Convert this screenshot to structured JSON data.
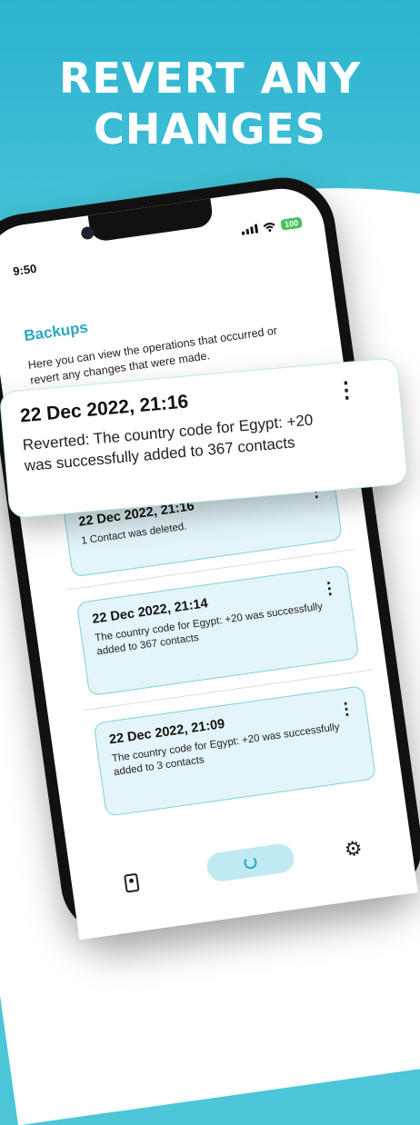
{
  "headline": {
    "line1": "REVERT ANY",
    "line2": "CHANGES"
  },
  "status": {
    "time": "9:50",
    "battery": "100"
  },
  "screen": {
    "title": "Backups",
    "description": "Here you can view the operations that occurred or revert any changes that were made."
  },
  "featured": {
    "date": "22 Dec 2022, 21:16",
    "message": "Reverted: The country code for Egypt: +20 was successfully added to 367 contacts",
    "more": "⋮"
  },
  "backups": [
    {
      "date": "22 Dec 2022, 21:16",
      "message": "1 Contact was deleted.",
      "more": "⋮"
    },
    {
      "date": "22 Dec 2022, 21:14",
      "message": "The country code for Egypt: +20 was successfully added to 367 contacts",
      "more": "⋮"
    },
    {
      "date": "22 Dec 2022, 21:09",
      "message": "The country code for Egypt: +20 was successfully added to 3 contacts",
      "more": "⋮"
    }
  ],
  "tabs": {
    "settings_glyph": "⚙"
  },
  "colors": {
    "accent": "#2aa9bf",
    "card_bg": "#e3f5f8",
    "background_top": "#2cb3d0",
    "battery": "#45c35b"
  },
  "icons": [
    "signal-icon",
    "wifi-icon",
    "battery-icon",
    "more-vertical-icon",
    "contacts-icon",
    "refresh-icon",
    "gear-icon"
  ]
}
